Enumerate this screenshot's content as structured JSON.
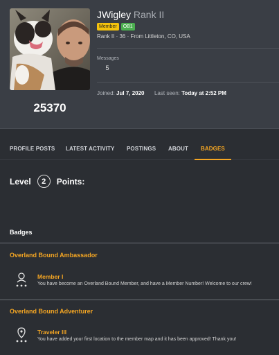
{
  "profile": {
    "username": "JWigley",
    "rank": "Rank II",
    "tags": [
      "Member",
      "OB1"
    ],
    "subline": "Rank II · 36 · From Littleton, CO, USA",
    "score": "25370",
    "messages_label": "Messages",
    "messages_value": "5",
    "joined_label": "Joined:",
    "joined_value": "Jul 7, 2020",
    "last_seen_label": "Last seen:",
    "last_seen_value": "Today at 2:52 PM"
  },
  "tabs": [
    "PROFILE POSTS",
    "LATEST ACTIVITY",
    "POSTINGS",
    "ABOUT",
    "BADGES"
  ],
  "active_tab": "BADGES",
  "level": {
    "level_label": "Level",
    "level_value": "2",
    "points_label": "Points:"
  },
  "badges": {
    "section_title": "Badges",
    "groups": [
      {
        "title": "Overland Bound Ambassador",
        "items": [
          {
            "icon": "person-icon",
            "name": "Member I",
            "description": "You have become an Overland Bound Member, and have a Member Number! Welcome to our crew!"
          }
        ]
      },
      {
        "title": "Overland Bound Adventurer",
        "items": [
          {
            "icon": "map-pin-icon",
            "name": "Traveler III",
            "description": "You have added your first location to the member map and it has been approved! Thank you!"
          }
        ]
      }
    ]
  },
  "colors": {
    "accent": "#f5a623",
    "background": "#2b2e33",
    "header_bg": "#3a3e45",
    "member_tag": "#f4c20d",
    "ob1_tag": "#4caf50"
  }
}
